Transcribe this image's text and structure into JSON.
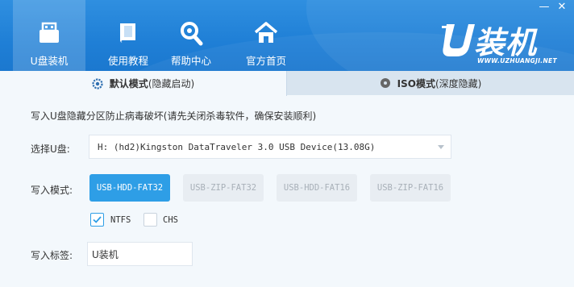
{
  "window": {
    "minimize_symbol": "—",
    "close_symbol": "✕"
  },
  "nav": [
    {
      "label": "U盘装机",
      "icon": "usb-drive-icon",
      "active": true
    },
    {
      "label": "使用教程",
      "icon": "book-icon",
      "active": false
    },
    {
      "label": "帮助中心",
      "icon": "magnifier-help-icon",
      "active": false
    },
    {
      "label": "官方首页",
      "icon": "home-icon",
      "active": false
    }
  ],
  "logo": {
    "text": "装机",
    "url_text": "WWW.UZHUANGJI.NET",
    "icon": "u-logo-icon"
  },
  "tabs": [
    {
      "main": "默认模式",
      "sub": "(隐藏启动)",
      "icon": "gear-icon",
      "active": true
    },
    {
      "main": "ISO模式",
      "sub": "(深度隐藏)",
      "icon": "disc-icon",
      "active": false
    }
  ],
  "content": {
    "hint": "写入U盘隐藏分区防止病毒破坏(请先关闭杀毒软件，确保安装顺利)",
    "disk_label": "选择U盘:",
    "disk_value": "H: (hd2)Kingston DataTraveler 3.0 USB Device(13.08G)",
    "mode_label": "写入模式:",
    "modes": [
      "USB-HDD-FAT32",
      "USB-ZIP-FAT32",
      "USB-HDD-FAT16",
      "USB-ZIP-FAT16"
    ],
    "selected_mode": "USB-HDD-FAT32",
    "options": [
      {
        "label": "NTFS",
        "checked": true
      },
      {
        "label": "CHS",
        "checked": false
      }
    ],
    "tag_label": "写入标签:",
    "tag_value": "U装机"
  },
  "colors": {
    "header_blue": "#1f7fd6",
    "accent": "#2e9ee6",
    "background": "#f3f8fc"
  }
}
